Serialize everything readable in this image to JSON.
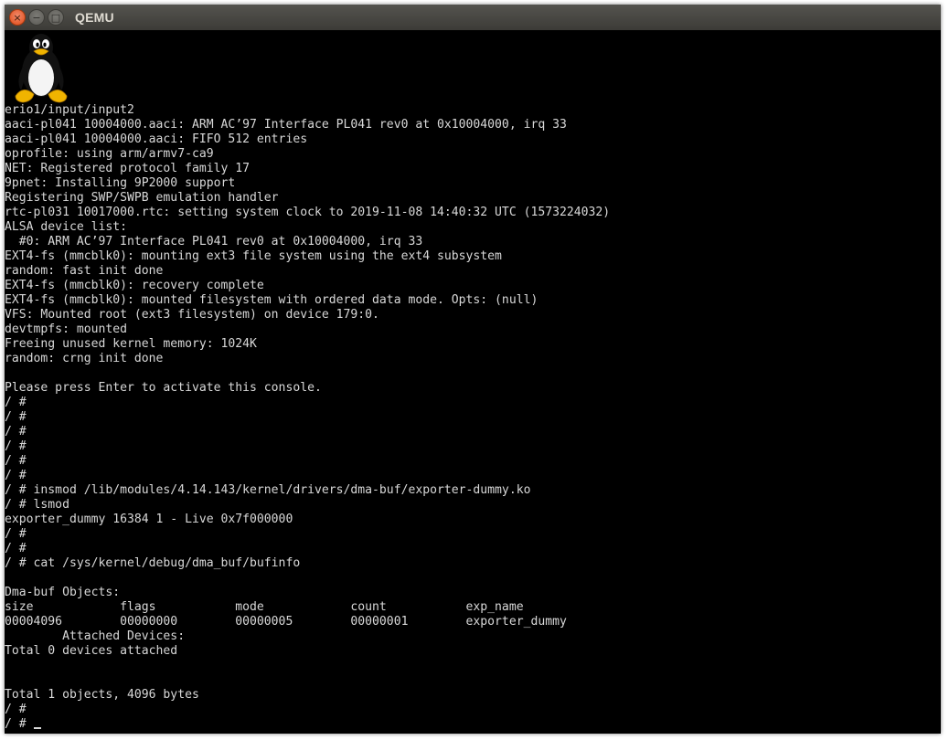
{
  "window": {
    "title": "QEMU",
    "controls": {
      "close_glyph": "×",
      "minimize_glyph": "−",
      "maximize_glyph": "□"
    }
  },
  "boot_logo": "tux-penguin-icon",
  "colors": {
    "titlebar": "#3c3b37",
    "close_button": "#df4a16",
    "console_bg": "#000000",
    "console_fg": "#d8d8d8"
  },
  "console": {
    "lines": [
      "erio1/input/input2",
      "aaci-pl041 10004000.aaci: ARM AC’97 Interface PL041 rev0 at 0x10004000, irq 33",
      "aaci-pl041 10004000.aaci: FIFO 512 entries",
      "oprofile: using arm/armv7-ca9",
      "NET: Registered protocol family 17",
      "9pnet: Installing 9P2000 support",
      "Registering SWP/SWPB emulation handler",
      "rtc-pl031 10017000.rtc: setting system clock to 2019-11-08 14:40:32 UTC (1573224032)",
      "ALSA device list:",
      "  #0: ARM AC’97 Interface PL041 rev0 at 0x10004000, irq 33",
      "EXT4-fs (mmcblk0): mounting ext3 file system using the ext4 subsystem",
      "random: fast init done",
      "EXT4-fs (mmcblk0): recovery complete",
      "EXT4-fs (mmcblk0): mounted filesystem with ordered data mode. Opts: (null)",
      "VFS: Mounted root (ext3 filesystem) on device 179:0.",
      "devtmpfs: mounted",
      "Freeing unused kernel memory: 1024K",
      "random: crng init done",
      "",
      "Please press Enter to activate this console.",
      "/ #",
      "/ #",
      "/ #",
      "/ #",
      "/ #",
      "/ #",
      "/ # insmod /lib/modules/4.14.143/kernel/drivers/dma-buf/exporter-dummy.ko",
      "/ # lsmod",
      "exporter_dummy 16384 1 - Live 0x7f000000",
      "/ #",
      "/ #",
      "/ # cat /sys/kernel/debug/dma_buf/bufinfo",
      "",
      "Dma-buf Objects:",
      "size            flags           mode            count           exp_name",
      "00004096        00000000        00000005        00000001        exporter_dummy",
      "        Attached Devices:",
      "Total 0 devices attached",
      "",
      "",
      "Total 1 objects, 4096 bytes",
      "/ #"
    ],
    "prompt": "/ # "
  }
}
